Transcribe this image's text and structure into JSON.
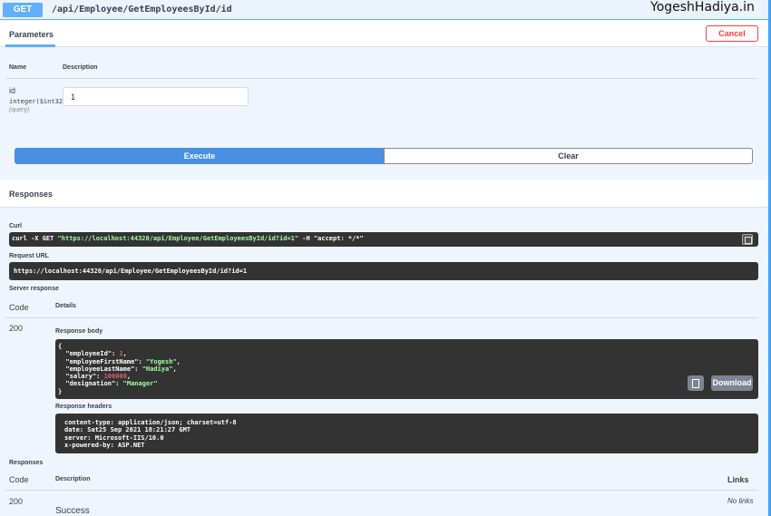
{
  "header": {
    "method": "GET",
    "path": "/api/Employee/GetEmployeesById/id",
    "brand": "YogeshHadiya.in"
  },
  "tabs": {
    "parameters": "Parameters",
    "cancel": "Cancel"
  },
  "params_table": {
    "col_name": "Name",
    "col_description": "Description",
    "rows": [
      {
        "name": "id",
        "type": "integer($int32)",
        "in": "(query)",
        "value": "1"
      }
    ]
  },
  "actions": {
    "execute": "Execute",
    "clear": "Clear"
  },
  "responses_section": {
    "title": "Responses",
    "curl_label": "Curl",
    "curl_prefix": "curl -X GET ",
    "curl_url": "\"https://localhost:44320/api/Employee/GetEmployeesById/id?id=1\"",
    "curl_mid": " -H  ",
    "curl_header": "\"accept: */*\"",
    "request_url_label": "Request URL",
    "request_url": "https://localhost:44320/api/Employee/GetEmployeesById/id?id=1",
    "server_response_label": "Server response",
    "col_code": "Code",
    "col_details": "Details",
    "code": "200",
    "response_body_label": "Response body",
    "body": {
      "open": "{",
      "k1": "  \"employeeId\": ",
      "v1": "1",
      "c1": ",",
      "k2": "  \"employeeFirstName\": ",
      "v2": "\"Yogesh\"",
      "c2": ",",
      "k3": "  \"employeeLastName\": ",
      "v3": "\"Hadiya\"",
      "c3": ",",
      "k4": "  \"salary\": ",
      "v4": "100000",
      "c4": ",",
      "k5": "  \"designation\": ",
      "v5": "\"Manager\"",
      "close": "}"
    },
    "download": "Download",
    "response_headers_label": "Response headers",
    "headers_text": "content-type: application/json; charset=utf-8\ndate: Sat25 Sep 2021 18:21:27 GMT\nserver: Microsoft-IIS/10.0\nx-powered-by: ASP.NET"
  },
  "responses_table": {
    "title": "Responses",
    "col_code": "Code",
    "col_description": "Description",
    "col_links": "Links",
    "rows": [
      {
        "code": "200",
        "description": "Success",
        "links": "No links"
      }
    ]
  },
  "colors": {
    "get_blue": "#61affe",
    "execute_blue": "#4990e2",
    "cancel_red": "#f93e3e",
    "dark_panel": "#333333"
  }
}
